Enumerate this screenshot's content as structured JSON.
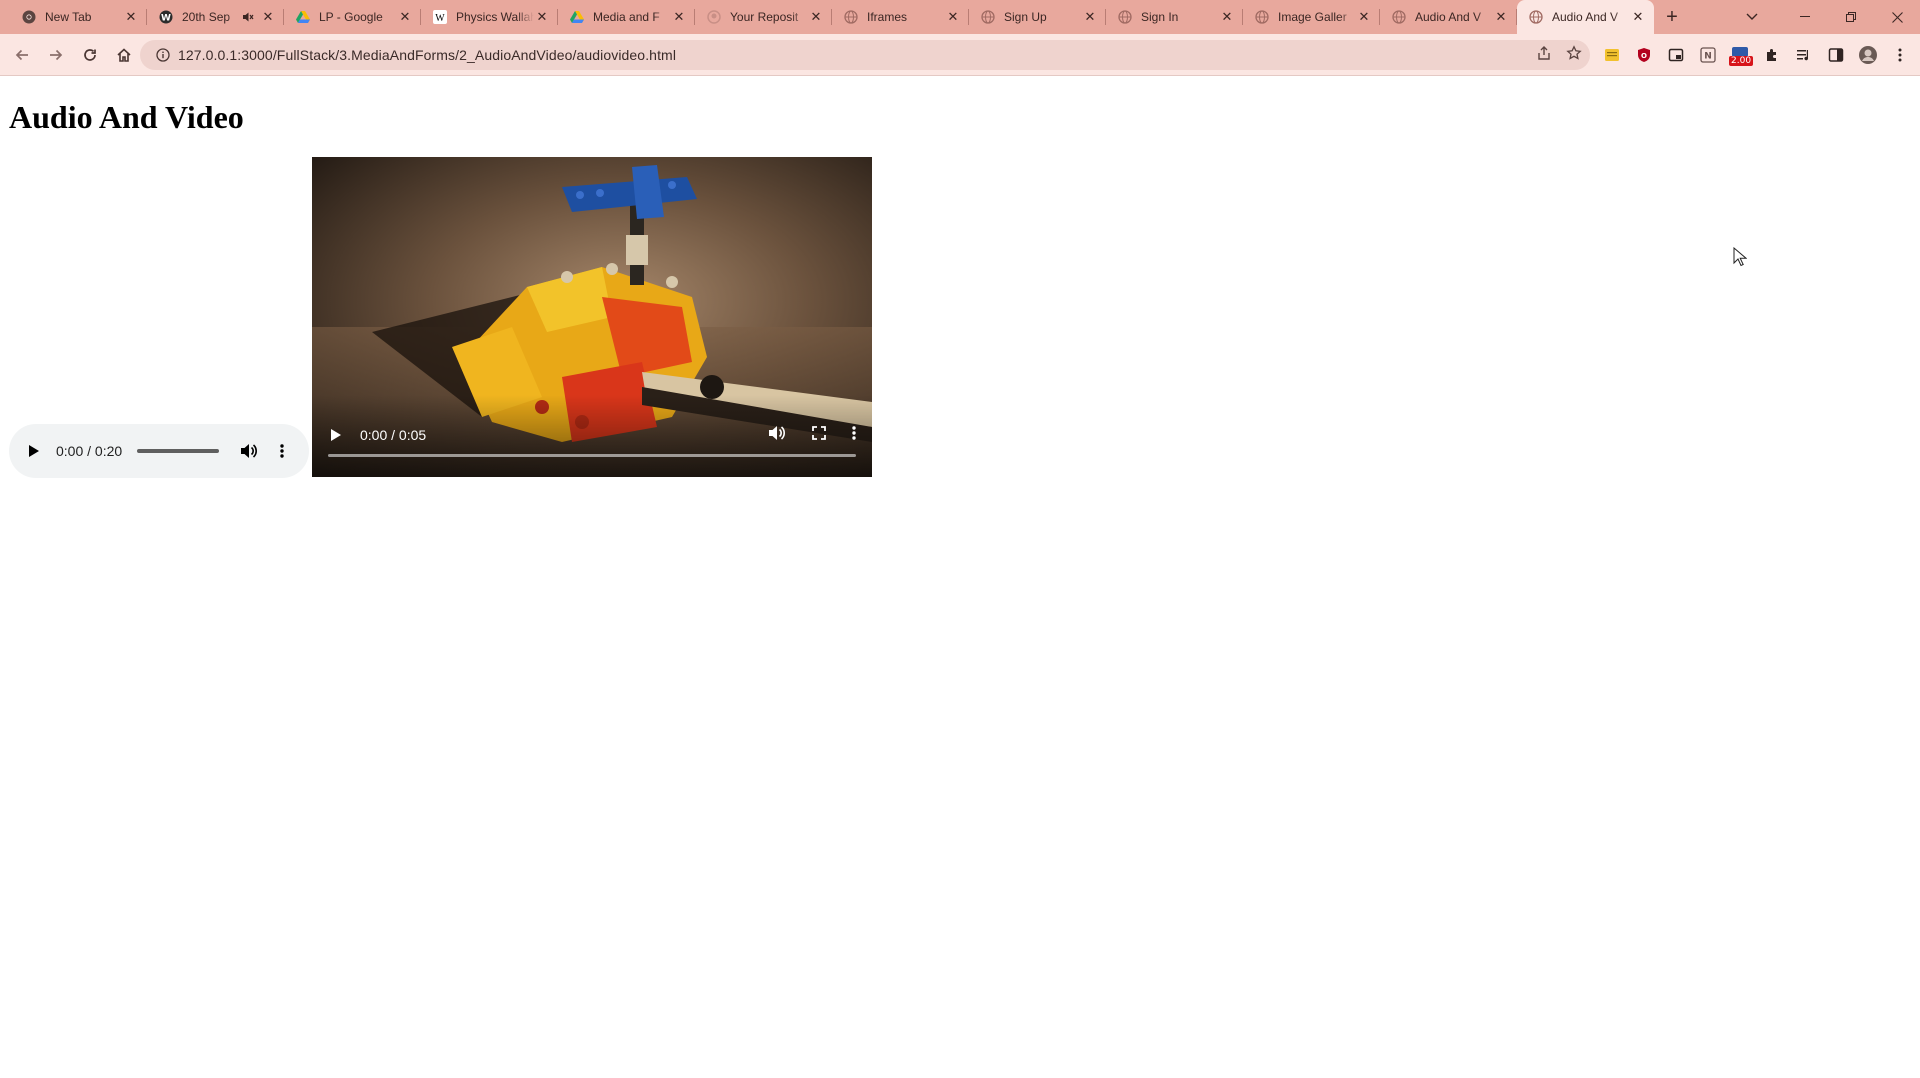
{
  "browser": {
    "tabs": [
      {
        "title": "New Tab",
        "icon": "chrome-icon",
        "active": false
      },
      {
        "title": "20th Sep",
        "icon": "globe-dark-icon",
        "active": false,
        "muted_indicator": true
      },
      {
        "title": "LP - Google",
        "icon": "google-drive-icon",
        "active": false
      },
      {
        "title": "Physics Wallah",
        "icon": "wikipedia-icon",
        "active": false
      },
      {
        "title": "Media and F",
        "icon": "google-drive-icon",
        "active": false
      },
      {
        "title": "Your Reposit",
        "icon": "github-icon",
        "active": false
      },
      {
        "title": "Iframes",
        "icon": "globe-icon",
        "active": false
      },
      {
        "title": "Sign Up",
        "icon": "globe-icon",
        "active": false
      },
      {
        "title": "Sign In",
        "icon": "globe-icon",
        "active": false
      },
      {
        "title": "Image Galler",
        "icon": "globe-icon",
        "active": false
      },
      {
        "title": "Audio And V",
        "icon": "globe-icon",
        "active": false
      },
      {
        "title": "Audio And V",
        "icon": "globe-icon",
        "active": true
      }
    ],
    "address_bar": {
      "url": "127.0.0.1:3000/FullStack/3.MediaAndForms/2_AudioAndVideo/audiovideo.html"
    },
    "extensions": [
      "sticky-note-icon",
      "shield-icon",
      "picture-in-picture-icon",
      "translate-icon",
      "counter-extension-icon",
      "puzzle-icon",
      "media-queue-icon",
      "sidebar-icon",
      "profile-avatar-icon",
      "menu-dots-icon"
    ],
    "extension_badge": "2.00",
    "colors": {
      "tabstrip_bg": "#e8a89d",
      "toolbar_bg": "#fbe6e2",
      "omnibox_bg": "#efd3ce"
    }
  },
  "page": {
    "heading": "Audio And Video",
    "audio": {
      "time": "0:00 / 0:20",
      "progress": 0
    },
    "video": {
      "time": "0:00 / 0:05",
      "progress": 0
    }
  }
}
